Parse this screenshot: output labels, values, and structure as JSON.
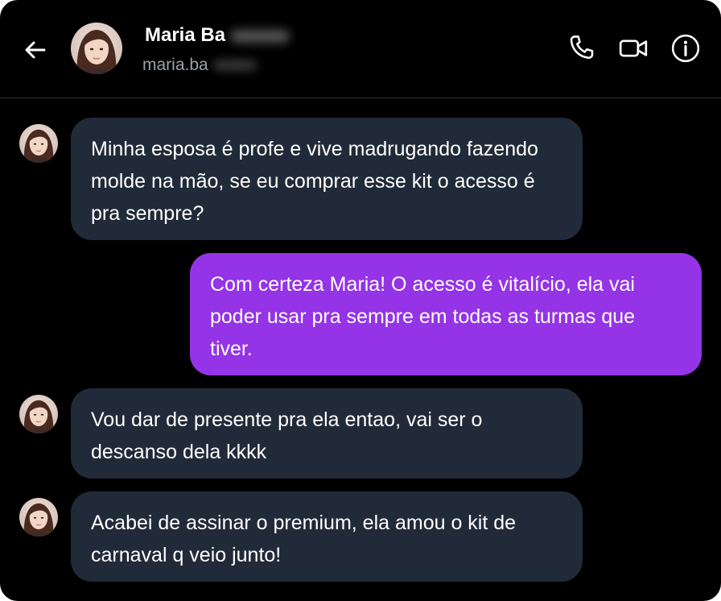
{
  "contact": {
    "name": "Maria Ba",
    "handle": "maria.ba"
  },
  "header": {
    "icons": [
      "back-arrow-icon",
      "phone-icon",
      "video-camera-icon",
      "info-icon"
    ]
  },
  "colors": {
    "background": "#000000",
    "incoming_bubble": "#212a38",
    "outgoing_bubble": "#9434e6",
    "text": "#ffffff",
    "handle": "#9aa0a6"
  },
  "messages": [
    {
      "direction": "incoming",
      "text": "Minha esposa é profe e vive madrugando fazendo molde na mão, se eu comprar esse kit o acesso é pra sempre?"
    },
    {
      "direction": "outgoing",
      "text": "Com certeza Maria! O acesso é vitalício, ela vai poder usar pra sempre em todas as turmas que tiver."
    },
    {
      "direction": "incoming",
      "text": "Vou dar de presente pra ela entao, vai ser o descanso dela kkkk"
    },
    {
      "direction": "incoming",
      "text": "Acabei de assinar o premium, ela amou o kit de carnaval q veio junto!"
    }
  ]
}
